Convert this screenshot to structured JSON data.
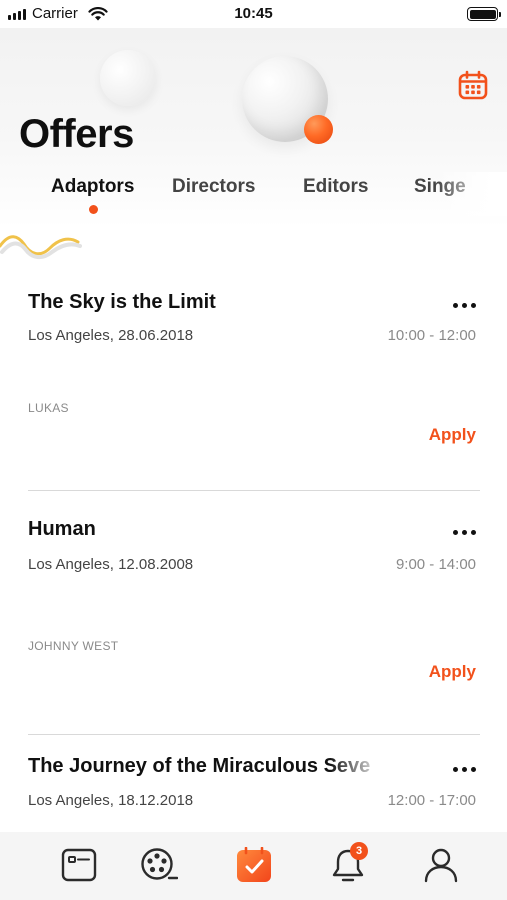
{
  "status_bar": {
    "carrier": "Carrier",
    "time": "10:45",
    "icons": [
      "signal-icon",
      "wifi-icon",
      "battery-icon"
    ]
  },
  "header": {
    "title": "Offers",
    "calendar_icon": "calendar-icon"
  },
  "tabs": [
    {
      "label": "Adaptors",
      "active": true
    },
    {
      "label": "Directors",
      "active": false
    },
    {
      "label": "Editors",
      "active": false
    },
    {
      "label": "Singe",
      "active": false
    }
  ],
  "offers": [
    {
      "title": "The Sky is the Limit",
      "location_date": "Los Angeles, 28.06.2018",
      "time": "10:00 - 12:00",
      "author": "LUKAS",
      "action": "Apply"
    },
    {
      "title": "Human",
      "location_date": "Los Angeles, 12.08.2008",
      "time": "9:00 - 14:00",
      "author": "JOHNNY WEST",
      "action": "Apply"
    },
    {
      "title": "The Journey of the Miraculous Seve",
      "location_date": "Los Angeles, 18.12.2018",
      "time": "12:00 - 17:00"
    }
  ],
  "bottom_nav": {
    "items": [
      {
        "icon": "id-card-icon"
      },
      {
        "icon": "film-reel-icon"
      },
      {
        "icon": "calendar-check-icon",
        "active": true
      },
      {
        "icon": "bell-icon",
        "badge": "3"
      },
      {
        "icon": "profile-icon"
      }
    ]
  },
  "colors": {
    "accent": "#f2511b",
    "text": "#141414",
    "muted": "#8a8a8a",
    "nav_bg": "#f5f5f5"
  }
}
